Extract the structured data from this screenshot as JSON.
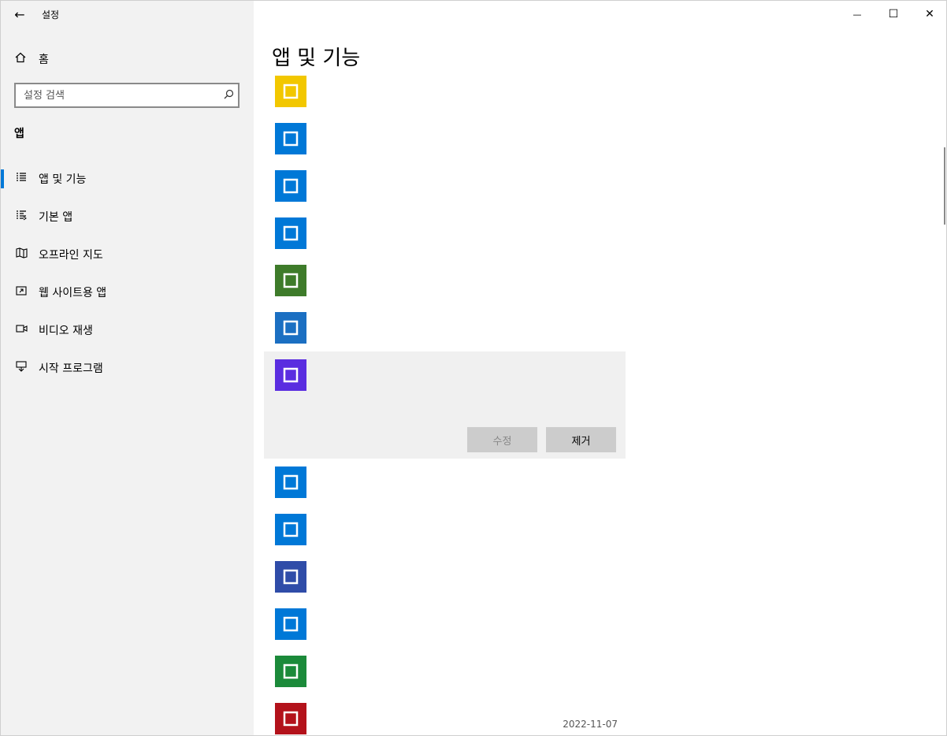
{
  "window": {
    "app_title": "설정",
    "back_icon": "←",
    "controls": {
      "minimize": "—",
      "maximize": "☐",
      "close": "✕"
    }
  },
  "sidebar": {
    "home_label": "홈",
    "search_placeholder": "설정 검색",
    "section_header": "앱",
    "items": [
      {
        "label": "앱 및 기능",
        "icon": "apps-features-icon",
        "active": true
      },
      {
        "label": "기본 앱",
        "icon": "default-apps-icon",
        "active": false
      },
      {
        "label": "오프라인 지도",
        "icon": "offline-maps-icon",
        "active": false
      },
      {
        "label": "웹 사이트용 앱",
        "icon": "apps-for-websites-icon",
        "active": false
      },
      {
        "label": "비디오 재생",
        "icon": "video-playback-icon",
        "active": false
      },
      {
        "label": "시작 프로그램",
        "icon": "startup-icon",
        "active": false
      }
    ]
  },
  "main": {
    "page_title": "앱 및 기능",
    "apps": [
      {
        "name": "",
        "publisher": "",
        "size": "",
        "date": "",
        "icon_color": "#f2c700"
      },
      {
        "name": "",
        "publisher": "",
        "size": "",
        "date": "",
        "icon_color": "#0078d7"
      },
      {
        "name": "",
        "publisher": "",
        "size": "",
        "date": "",
        "icon_color": "#0078d7"
      },
      {
        "name": "",
        "publisher": "",
        "size": "",
        "date": "",
        "icon_color": "#0078d7"
      },
      {
        "name": "",
        "publisher": "",
        "size": "",
        "date": "",
        "icon_color": "#3e7b2a"
      },
      {
        "name": "",
        "publisher": "",
        "size": "",
        "date": "",
        "icon_color": "#1b6fc2"
      },
      {
        "name": "",
        "publisher": "",
        "size": "",
        "date": "",
        "icon_color": "#5a2de0",
        "selected": true,
        "version": ""
      },
      {
        "name": "",
        "publisher": "",
        "size": "",
        "date": "",
        "icon_color": "#0078d7"
      },
      {
        "name": "",
        "publisher": "",
        "size": "",
        "date": "",
        "icon_color": "#0078d7"
      },
      {
        "name": "",
        "publisher": "",
        "size": "",
        "date": "",
        "icon_color": "#2f4ca8"
      },
      {
        "name": "",
        "publisher": "",
        "size": "",
        "date": "",
        "icon_color": "#0078d7"
      },
      {
        "name": "",
        "publisher": "",
        "size": "",
        "date": "",
        "icon_color": "#1b8a3a"
      },
      {
        "name": "",
        "publisher": "",
        "size": "",
        "date": "2022-11-07",
        "icon_color": "#b3121b"
      }
    ],
    "modify_label": "수정",
    "remove_label": "제거"
  }
}
